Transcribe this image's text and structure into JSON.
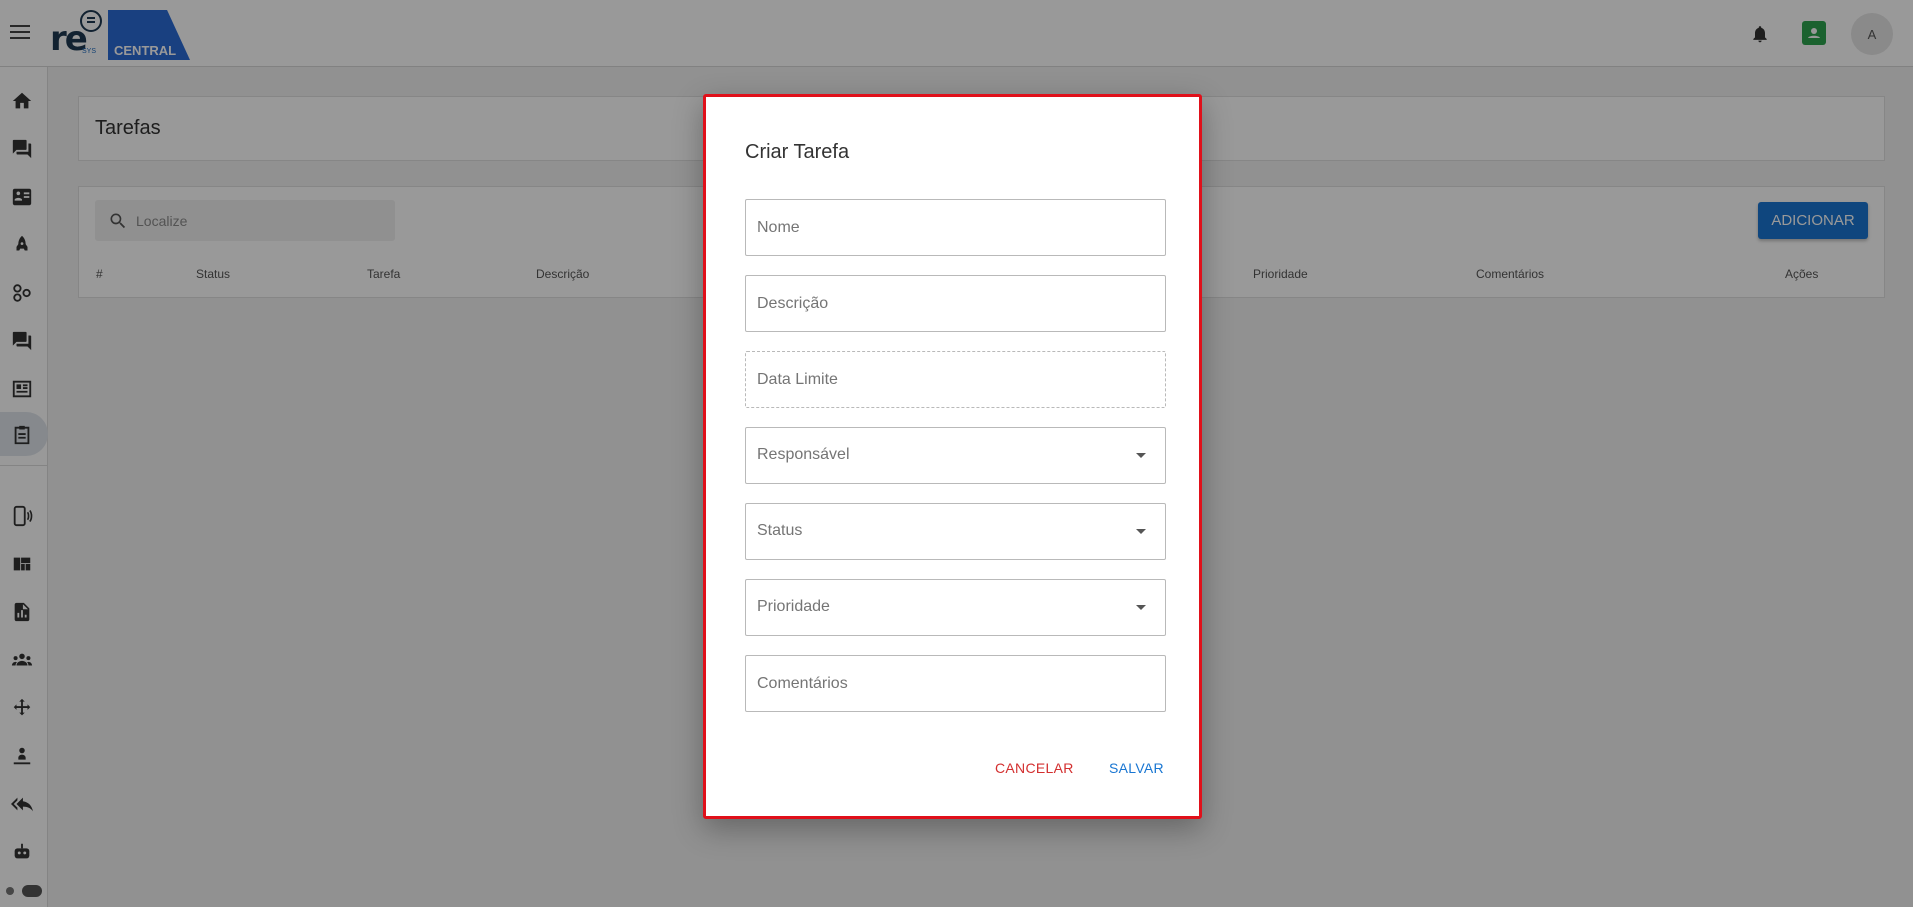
{
  "header": {
    "logo": {
      "re": "re",
      "sys": "SYS",
      "central": "CENTRAL"
    },
    "avatar_initial": "A",
    "icons": [
      "menu-icon",
      "bell-icon",
      "contact-icon"
    ],
    "colors": {
      "brand_blue": "#2a6bd6",
      "badge_green": "#2ea44f"
    }
  },
  "sidebar": {
    "items": [
      {
        "icon": "home-icon"
      },
      {
        "icon": "chat-icon"
      },
      {
        "icon": "contact-card-icon"
      },
      {
        "icon": "rocket-icon"
      },
      {
        "icon": "hub-icon"
      },
      {
        "icon": "forum-icon"
      },
      {
        "icon": "newspaper-icon"
      },
      {
        "icon": "clipboard-icon",
        "active": true
      },
      {
        "icon": "phone-signal-icon"
      },
      {
        "icon": "dashboard-icon"
      },
      {
        "icon": "report-icon"
      },
      {
        "icon": "groups-icon"
      },
      {
        "icon": "move-icon"
      },
      {
        "icon": "person-pin-icon"
      },
      {
        "icon": "reply-all-icon"
      },
      {
        "icon": "robot-icon"
      }
    ]
  },
  "page": {
    "title": "Tarefas",
    "search_placeholder": "Localize",
    "add_label": "ADICIONAR",
    "columns": [
      "#",
      "Status",
      "Tarefa",
      "Descrição",
      "Prioridade",
      "Comentários",
      "Ações"
    ]
  },
  "dialog": {
    "title": "Criar Tarefa",
    "fields": {
      "nome": "Nome",
      "descricao": "Descrição",
      "data_limite": "Data Limite",
      "responsavel": "Responsável",
      "status": "Status",
      "prioridade": "Prioridade",
      "comentarios": "Comentários"
    },
    "cancel_label": "CANCELAR",
    "save_label": "SALVAR",
    "colors": {
      "cancel": "#d32f2f",
      "save": "#1976d2",
      "highlight_border": "#e0101a"
    }
  }
}
